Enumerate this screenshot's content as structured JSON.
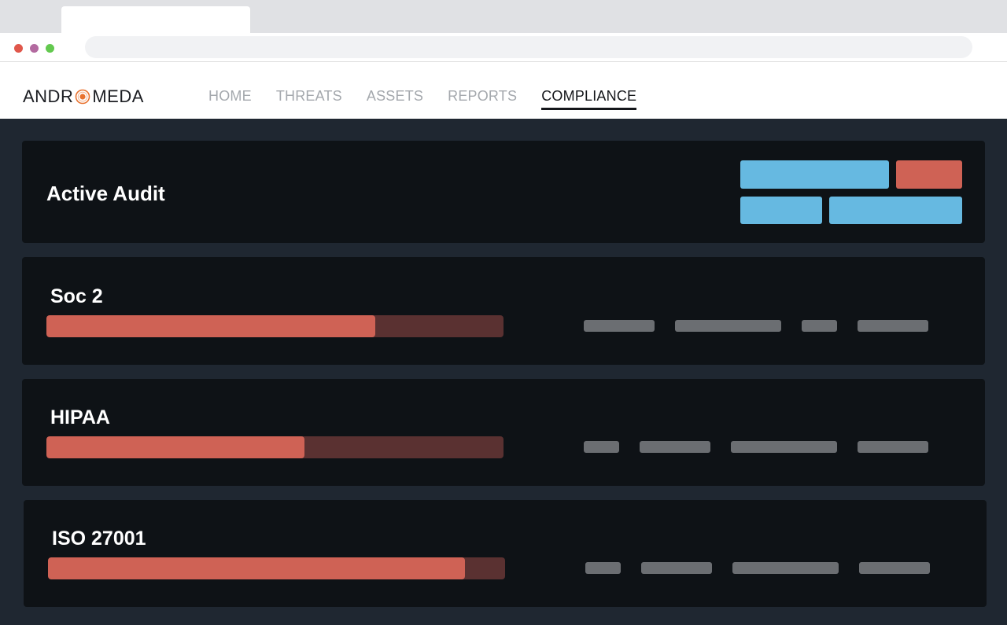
{
  "app": {
    "logo_text_left": "ANDR",
    "logo_text_right": "MEDA",
    "logo_icon": "orbit-o-icon",
    "accent_color": "#e8722f"
  },
  "nav": {
    "items": [
      {
        "label": "HOME"
      },
      {
        "label": "THREATS"
      },
      {
        "label": "ASSETS"
      },
      {
        "label": "REPORTS"
      },
      {
        "label": "COMPLIANCE",
        "active": true
      }
    ]
  },
  "audit": {
    "title": "Active Audit",
    "button_colors": {
      "primary": "#66b9e1",
      "danger": "#cf6255"
    }
  },
  "frameworks": [
    {
      "name": "Soc 2",
      "progress": 0.72
    },
    {
      "name": "HIPAA",
      "progress": 0.565
    },
    {
      "name": "ISO 27001",
      "progress": 0.912
    }
  ],
  "colors": {
    "progress_fill": "#cf6255",
    "progress_track": "#5a3131",
    "panel_bg": "#0e1216",
    "page_bg": "#1f2731"
  }
}
